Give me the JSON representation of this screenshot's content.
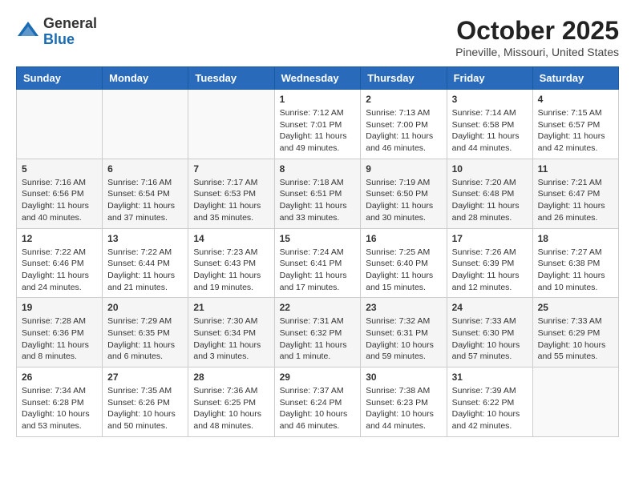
{
  "header": {
    "logo": {
      "general": "General",
      "blue": "Blue"
    },
    "title": "October 2025",
    "location": "Pineville, Missouri, United States"
  },
  "weekdays": [
    "Sunday",
    "Monday",
    "Tuesday",
    "Wednesday",
    "Thursday",
    "Friday",
    "Saturday"
  ],
  "weeks": [
    [
      {
        "day": "",
        "info": ""
      },
      {
        "day": "",
        "info": ""
      },
      {
        "day": "",
        "info": ""
      },
      {
        "day": "1",
        "sunrise": "7:12 AM",
        "sunset": "7:01 PM",
        "daylight": "11 hours and 49 minutes."
      },
      {
        "day": "2",
        "sunrise": "7:13 AM",
        "sunset": "7:00 PM",
        "daylight": "11 hours and 46 minutes."
      },
      {
        "day": "3",
        "sunrise": "7:14 AM",
        "sunset": "6:58 PM",
        "daylight": "11 hours and 44 minutes."
      },
      {
        "day": "4",
        "sunrise": "7:15 AM",
        "sunset": "6:57 PM",
        "daylight": "11 hours and 42 minutes."
      }
    ],
    [
      {
        "day": "5",
        "sunrise": "7:16 AM",
        "sunset": "6:56 PM",
        "daylight": "11 hours and 40 minutes."
      },
      {
        "day": "6",
        "sunrise": "7:16 AM",
        "sunset": "6:54 PM",
        "daylight": "11 hours and 37 minutes."
      },
      {
        "day": "7",
        "sunrise": "7:17 AM",
        "sunset": "6:53 PM",
        "daylight": "11 hours and 35 minutes."
      },
      {
        "day": "8",
        "sunrise": "7:18 AM",
        "sunset": "6:51 PM",
        "daylight": "11 hours and 33 minutes."
      },
      {
        "day": "9",
        "sunrise": "7:19 AM",
        "sunset": "6:50 PM",
        "daylight": "11 hours and 30 minutes."
      },
      {
        "day": "10",
        "sunrise": "7:20 AM",
        "sunset": "6:48 PM",
        "daylight": "11 hours and 28 minutes."
      },
      {
        "day": "11",
        "sunrise": "7:21 AM",
        "sunset": "6:47 PM",
        "daylight": "11 hours and 26 minutes."
      }
    ],
    [
      {
        "day": "12",
        "sunrise": "7:22 AM",
        "sunset": "6:46 PM",
        "daylight": "11 hours and 24 minutes."
      },
      {
        "day": "13",
        "sunrise": "7:22 AM",
        "sunset": "6:44 PM",
        "daylight": "11 hours and 21 minutes."
      },
      {
        "day": "14",
        "sunrise": "7:23 AM",
        "sunset": "6:43 PM",
        "daylight": "11 hours and 19 minutes."
      },
      {
        "day": "15",
        "sunrise": "7:24 AM",
        "sunset": "6:41 PM",
        "daylight": "11 hours and 17 minutes."
      },
      {
        "day": "16",
        "sunrise": "7:25 AM",
        "sunset": "6:40 PM",
        "daylight": "11 hours and 15 minutes."
      },
      {
        "day": "17",
        "sunrise": "7:26 AM",
        "sunset": "6:39 PM",
        "daylight": "11 hours and 12 minutes."
      },
      {
        "day": "18",
        "sunrise": "7:27 AM",
        "sunset": "6:38 PM",
        "daylight": "11 hours and 10 minutes."
      }
    ],
    [
      {
        "day": "19",
        "sunrise": "7:28 AM",
        "sunset": "6:36 PM",
        "daylight": "11 hours and 8 minutes."
      },
      {
        "day": "20",
        "sunrise": "7:29 AM",
        "sunset": "6:35 PM",
        "daylight": "11 hours and 6 minutes."
      },
      {
        "day": "21",
        "sunrise": "7:30 AM",
        "sunset": "6:34 PM",
        "daylight": "11 hours and 3 minutes."
      },
      {
        "day": "22",
        "sunrise": "7:31 AM",
        "sunset": "6:32 PM",
        "daylight": "11 hours and 1 minute."
      },
      {
        "day": "23",
        "sunrise": "7:32 AM",
        "sunset": "6:31 PM",
        "daylight": "10 hours and 59 minutes."
      },
      {
        "day": "24",
        "sunrise": "7:33 AM",
        "sunset": "6:30 PM",
        "daylight": "10 hours and 57 minutes."
      },
      {
        "day": "25",
        "sunrise": "7:33 AM",
        "sunset": "6:29 PM",
        "daylight": "10 hours and 55 minutes."
      }
    ],
    [
      {
        "day": "26",
        "sunrise": "7:34 AM",
        "sunset": "6:28 PM",
        "daylight": "10 hours and 53 minutes."
      },
      {
        "day": "27",
        "sunrise": "7:35 AM",
        "sunset": "6:26 PM",
        "daylight": "10 hours and 50 minutes."
      },
      {
        "day": "28",
        "sunrise": "7:36 AM",
        "sunset": "6:25 PM",
        "daylight": "10 hours and 48 minutes."
      },
      {
        "day": "29",
        "sunrise": "7:37 AM",
        "sunset": "6:24 PM",
        "daylight": "10 hours and 46 minutes."
      },
      {
        "day": "30",
        "sunrise": "7:38 AM",
        "sunset": "6:23 PM",
        "daylight": "10 hours and 44 minutes."
      },
      {
        "day": "31",
        "sunrise": "7:39 AM",
        "sunset": "6:22 PM",
        "daylight": "10 hours and 42 minutes."
      },
      {
        "day": "",
        "info": ""
      }
    ]
  ]
}
